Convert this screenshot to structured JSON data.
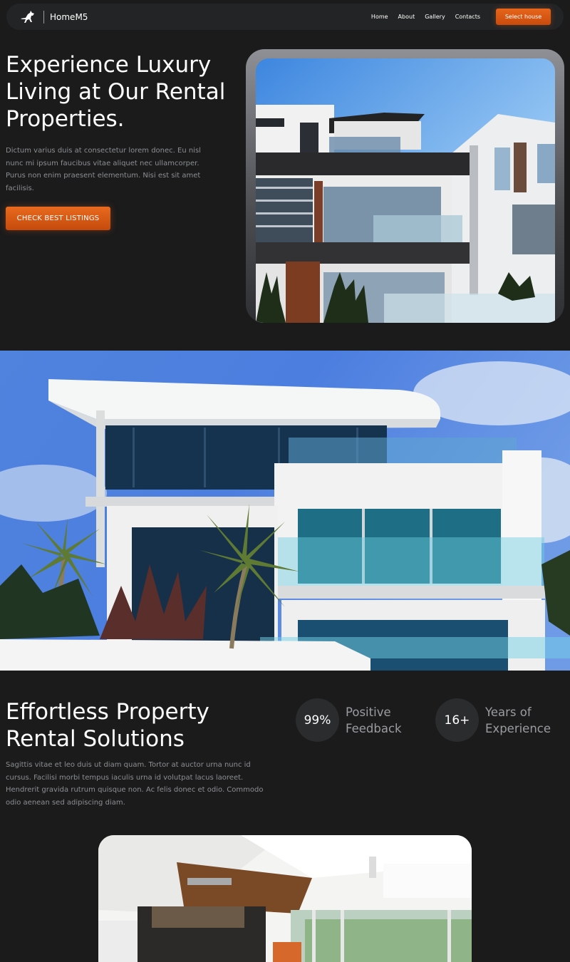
{
  "nav": {
    "brand": "HomeM5",
    "links": [
      "Home",
      "About",
      "Gallery",
      "Contacts"
    ],
    "cta": "Select house"
  },
  "hero": {
    "title": "Experience Luxury Living at Our Rental Properties.",
    "description": "Dictum varius duis at consectetur lorem donec. Eu nisl nunc mi ipsum faucibus vitae aliquet nec ullamcorper. Purus non enim praesent elementum. Nisi est sit amet facilisis.",
    "cta": "CHECK BEST LISTINGS"
  },
  "solutions": {
    "title": "Effortless Property Rental Solutions",
    "description": "Sagittis vitae et leo duis ut diam quam. Tortor at auctor urna nunc id cursus. Facilisi morbi tempus iaculis urna id volutpat lacus laoreet. Hendrerit gravida rutrum quisque non. Ac felis donec et odio. Commodo odio aenean sed adipiscing diam.",
    "stats": [
      {
        "value": "99%",
        "label": "Positive Feedback"
      },
      {
        "value": "16+",
        "label": "Years of Experience"
      }
    ]
  },
  "colors": {
    "background": "#1b1b1c",
    "accent": "#e0601a",
    "muted_text": "#8c8e92"
  }
}
